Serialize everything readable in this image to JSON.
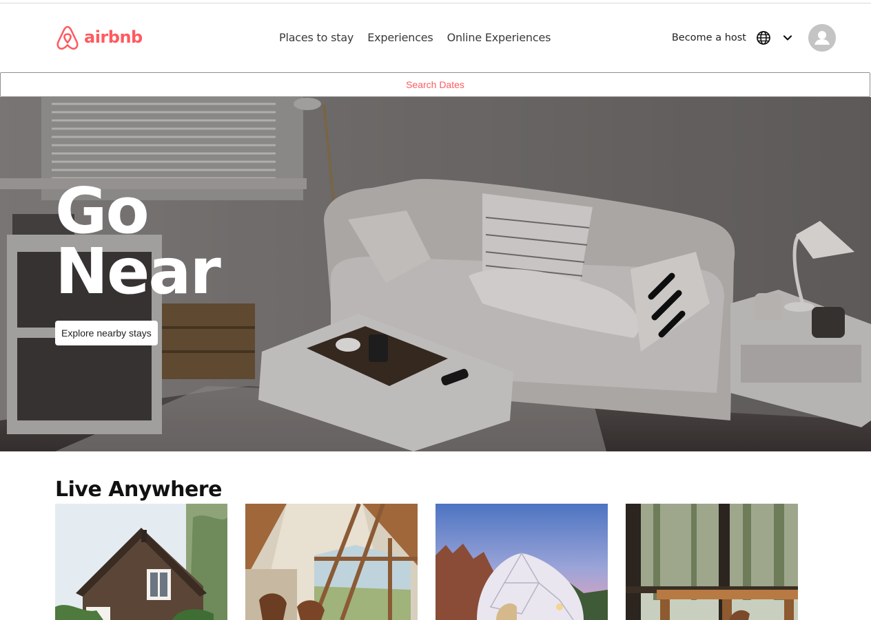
{
  "header": {
    "logo_text": "airbnb",
    "nav": [
      "Places to stay",
      "Experiences",
      "Online Experiences"
    ],
    "become_host": "Become a host",
    "icons": [
      "airbnb-logo-icon",
      "globe-icon",
      "chevron-down-icon",
      "user-avatar-icon"
    ]
  },
  "search": {
    "label": "Search Dates"
  },
  "hero": {
    "title_line1": "Go",
    "title_line2": "Near",
    "button": "Explore nearby stays"
  },
  "live_anywhere": {
    "title": "Live Anywhere",
    "cards": [
      "cabin-house-image",
      "a-frame-interior-image",
      "geodesic-dome-image",
      "forest-deck-image"
    ]
  },
  "colors": {
    "brand": "#ff5a5f",
    "text": "#222222",
    "hero_overlay": "#5a5756"
  }
}
